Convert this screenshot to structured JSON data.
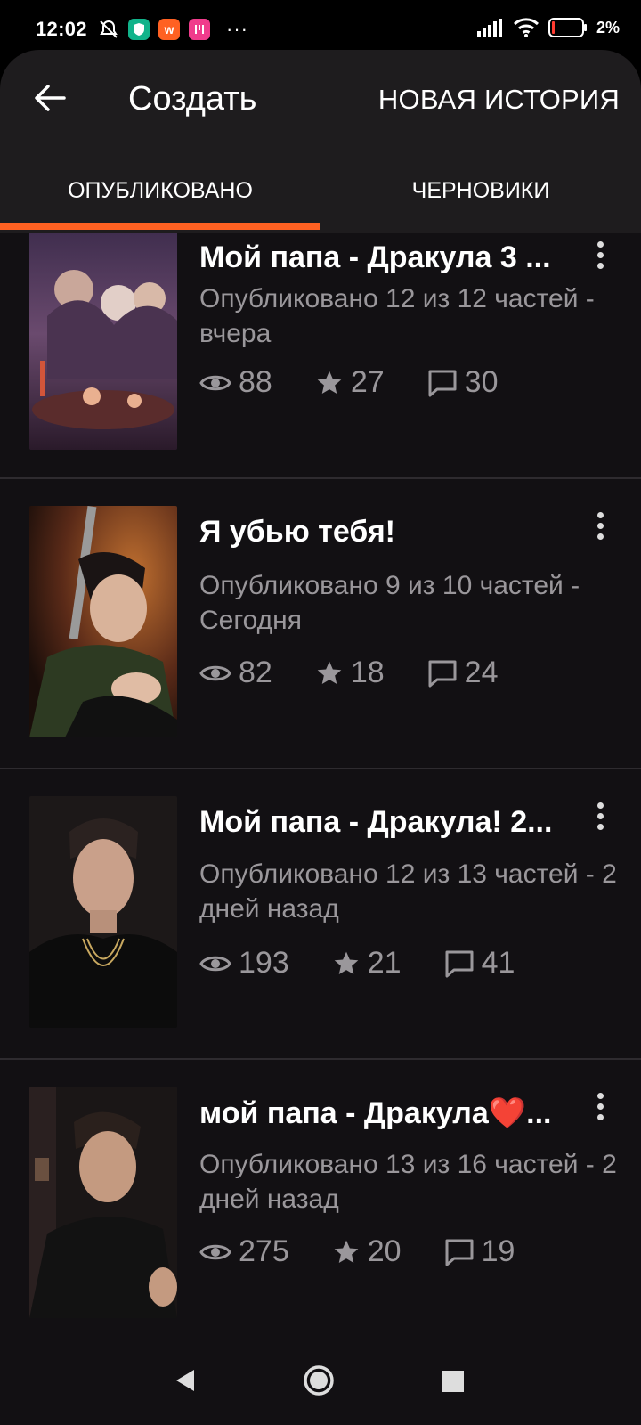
{
  "status_bar": {
    "time": "12:02",
    "more": "···",
    "battery": "2%"
  },
  "app_bar": {
    "title": "Создать",
    "new_story": "НОВАЯ ИСТОРИЯ"
  },
  "tabs": [
    {
      "label": "ОПУБЛИКОВАНО",
      "active": true
    },
    {
      "label": "ЧЕРНОВИКИ",
      "active": false
    }
  ],
  "stories": [
    {
      "title": "Мой папа - Дракула 3 ...",
      "meta": "Опубликовано 12 из 12 частей - вчера",
      "views": "88",
      "votes": "27",
      "comments": "30"
    },
    {
      "title": "Я убью тебя!",
      "meta": "Опубликовано 9 из 10 частей - Сегодня",
      "views": "82",
      "votes": "18",
      "comments": "24"
    },
    {
      "title": "Мой папа - Дракула! 2...",
      "meta": "Опубликовано 12 из 13 частей - 2 дней назад",
      "views": "193",
      "votes": "21",
      "comments": "41"
    },
    {
      "title": "мой папа - Дракула❤️...",
      "meta": "Опубликовано 13 из 16 частей - 2 дней назад",
      "views": "275",
      "votes": "20",
      "comments": "19"
    }
  ],
  "colors": {
    "accent": "#ff6122",
    "bar_bg": "#1e1c1e",
    "list_bg": "#121013",
    "muted_text": "#9a979b"
  },
  "icons": [
    "back-arrow-icon",
    "eye-icon",
    "star-icon",
    "comment-icon",
    "more-vertical-icon",
    "nav-back-icon",
    "nav-home-icon",
    "nav-recents-icon"
  ]
}
